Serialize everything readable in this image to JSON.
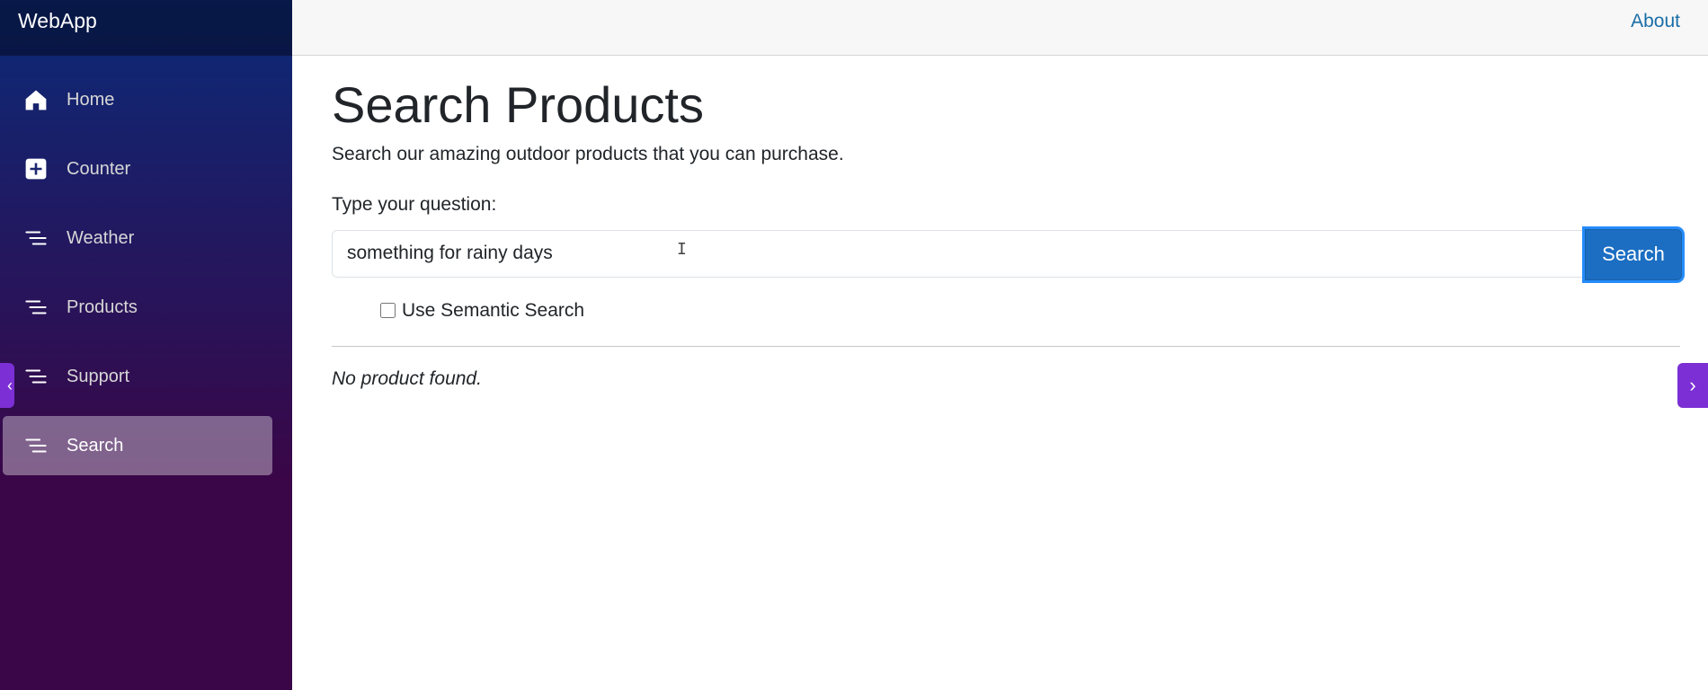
{
  "app": {
    "brand": "WebApp"
  },
  "sidebar": {
    "items": [
      {
        "label": "Home",
        "icon": "house-icon",
        "active": false
      },
      {
        "label": "Counter",
        "icon": "plus-square-icon",
        "active": false
      },
      {
        "label": "Weather",
        "icon": "list-icon",
        "active": false
      },
      {
        "label": "Products",
        "icon": "list-icon",
        "active": false
      },
      {
        "label": "Support",
        "icon": "list-icon",
        "active": false
      },
      {
        "label": "Search",
        "icon": "list-icon",
        "active": true
      }
    ]
  },
  "header": {
    "about_label": "About"
  },
  "main": {
    "title": "Search Products",
    "subtitle": "Search our amazing outdoor products that you can purchase.",
    "question_label": "Type your question:",
    "search_value": "something for rainy days",
    "search_button_label": "Search",
    "semantic_checkbox_label": "Use Semantic Search",
    "semantic_checked": false,
    "result_text": "No product found."
  },
  "colors": {
    "accent": "#1b6ec2",
    "tab_purple": "#7b2fd4",
    "link": "#1a6ea8"
  }
}
